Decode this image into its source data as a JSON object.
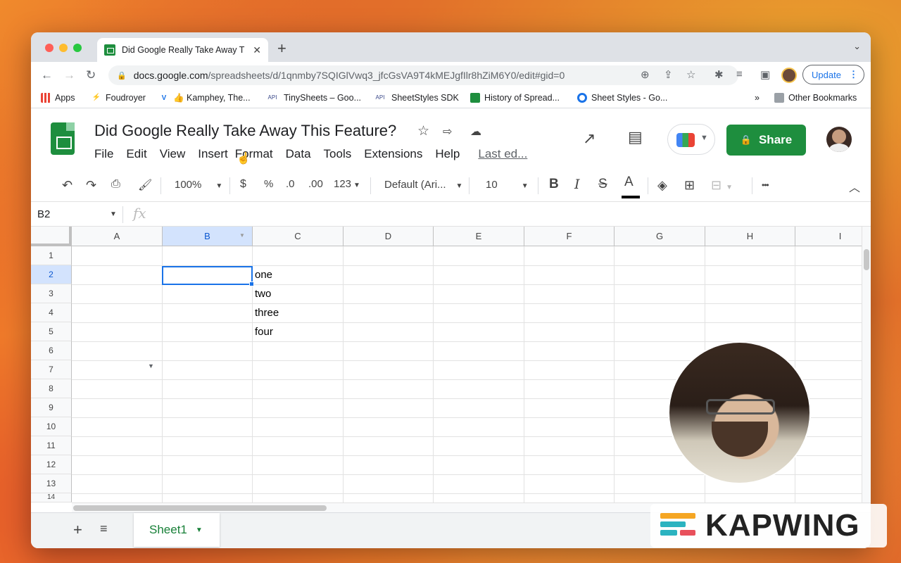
{
  "browser": {
    "tab_title": "Did Google Really Take Away T",
    "url_domain": "docs.google.com",
    "url_path": "/spreadsheets/d/1qnmby7SQIGlVwq3_jfcGsVA9T4kMEJgfIlr8hZiM6Y0/edit#gid=0",
    "update_label": "Update"
  },
  "bookmarks": [
    {
      "label": "Apps",
      "icon": "apps-grid-icon"
    },
    {
      "label": "Foudroyer",
      "icon": "bolt-icon"
    },
    {
      "label": "👍 Kamphey, The...",
      "icon": "v-icon"
    },
    {
      "label": "TinySheets – Goo...",
      "icon": "api-icon"
    },
    {
      "label": "SheetStyles SDK",
      "icon": "api-icon"
    },
    {
      "label": "History of Spread...",
      "icon": "sheets-icon"
    },
    {
      "label": "Sheet Styles - Go...",
      "icon": "circle-icon"
    }
  ],
  "bookmarks_more": "»",
  "bookmarks_other": "Other Bookmarks",
  "doc": {
    "title": "Did Google Really Take Away This Feature?",
    "menus": [
      "File",
      "Edit",
      "View",
      "Insert",
      "Format",
      "Data",
      "Tools",
      "Extensions",
      "Help"
    ],
    "last_edit": "Last ed...",
    "share_label": "Share"
  },
  "toolbar": {
    "zoom": "100%",
    "currency": "$",
    "percent": "%",
    "dec_decrease": ".0",
    "dec_increase": ".00",
    "more_formats": "123",
    "font": "Default (Ari...",
    "font_size": "10",
    "bold": "B",
    "italic": "I",
    "strike": "S",
    "text_color": "A",
    "more": "•••"
  },
  "formula": {
    "name_box": "B2",
    "fx": "fx"
  },
  "grid": {
    "columns": [
      "A",
      "B",
      "C",
      "D",
      "E",
      "F",
      "G",
      "H",
      "I"
    ],
    "rows": [
      "1",
      "2",
      "3",
      "4",
      "5",
      "6",
      "7",
      "8",
      "9",
      "10",
      "11",
      "12",
      "13",
      "14"
    ],
    "selected_cell": "B2",
    "cells": [
      {
        "ref": "C2",
        "value": "one"
      },
      {
        "ref": "C3",
        "value": "two"
      },
      {
        "ref": "C4",
        "value": "three"
      },
      {
        "ref": "C5",
        "value": "four"
      }
    ]
  },
  "sheets": {
    "add": "+",
    "list": "≡",
    "active": "Sheet1"
  },
  "watermark": "KAPWING",
  "colors": {
    "sheets_green": "#1e8e3e",
    "selection_blue": "#1a73e8"
  }
}
